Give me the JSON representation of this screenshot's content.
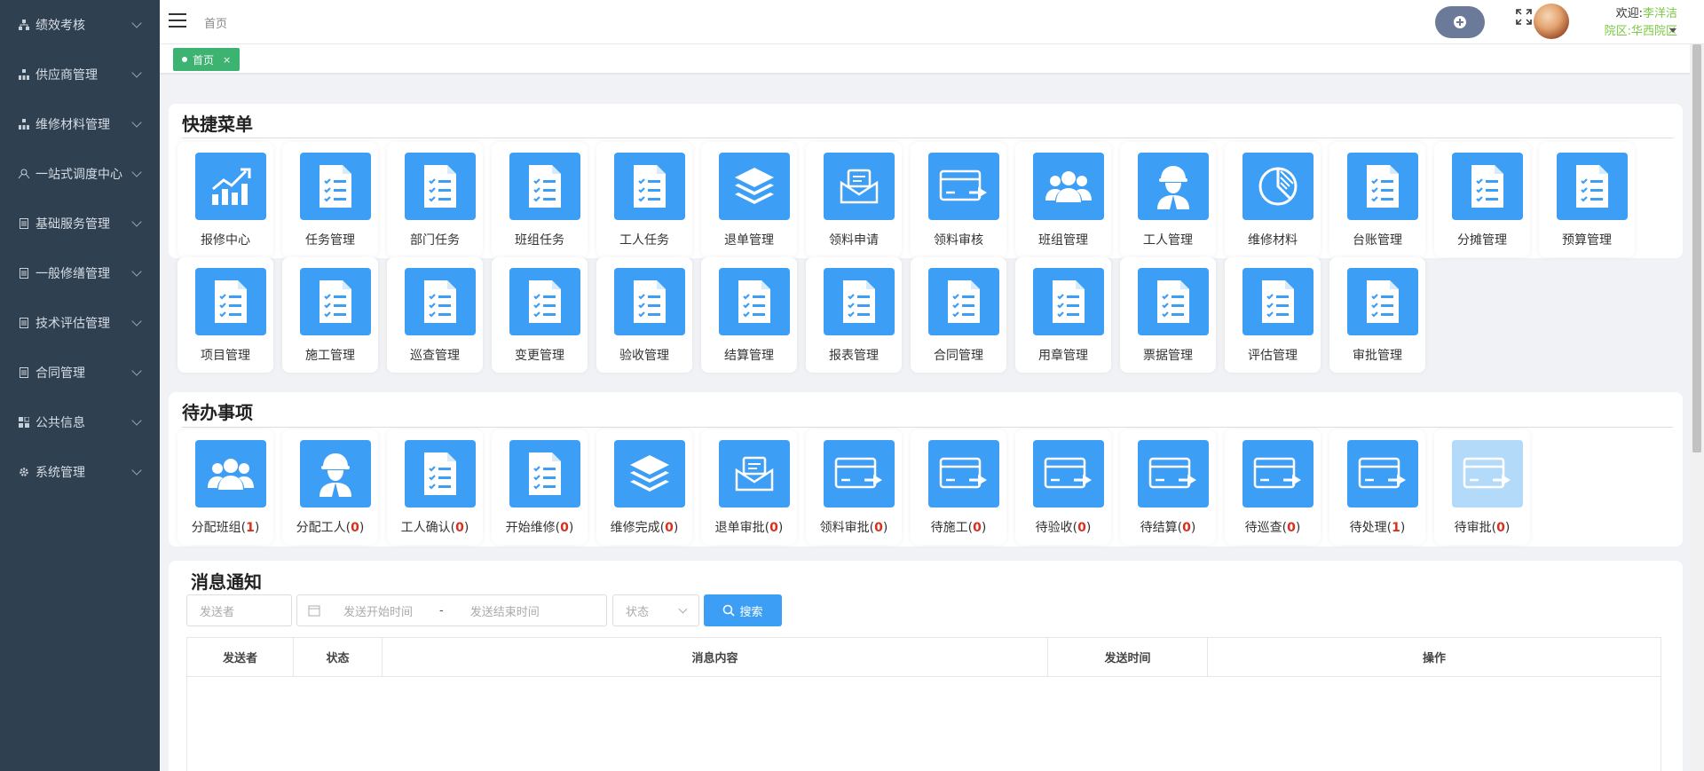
{
  "sidebar": {
    "items": [
      {
        "label": "绩效考核",
        "icon": "org-chart-icon"
      },
      {
        "label": "供应商管理",
        "icon": "sitemap-icon"
      },
      {
        "label": "维修材料管理",
        "icon": "sitemap-icon"
      },
      {
        "label": "一站式调度中心",
        "icon": "hub-icon"
      },
      {
        "label": "基础服务管理",
        "icon": "document-icon"
      },
      {
        "label": "一般修缮管理",
        "icon": "document-icon"
      },
      {
        "label": "技术评估管理",
        "icon": "document-icon"
      },
      {
        "label": "合同管理",
        "icon": "document-icon"
      },
      {
        "label": "公共信息",
        "icon": "grid-icon"
      },
      {
        "label": "系统管理",
        "icon": "gear-icon"
      }
    ]
  },
  "header": {
    "breadcrumb": "首页",
    "welcome_prefix": "欢迎:",
    "user_name": "李洋洁",
    "campus_prefix": "院区:",
    "campus_name": "华西院区"
  },
  "tabs": [
    {
      "label": "首页",
      "close": "×"
    }
  ],
  "quick_menu": {
    "title": "快捷菜单",
    "items": [
      {
        "label": "报修中心",
        "icon": "chart-up-icon"
      },
      {
        "label": "任务管理",
        "icon": "checklist-doc-icon"
      },
      {
        "label": "部门任务",
        "icon": "checklist-doc-icon"
      },
      {
        "label": "班组任务",
        "icon": "checklist-doc-icon"
      },
      {
        "label": "工人任务",
        "icon": "checklist-doc-icon"
      },
      {
        "label": "退单管理",
        "icon": "layers-icon"
      },
      {
        "label": "领料申请",
        "icon": "mail-icon"
      },
      {
        "label": "领料审核",
        "icon": "card-transfer-icon"
      },
      {
        "label": "班组管理",
        "icon": "users-icon"
      },
      {
        "label": "工人管理",
        "icon": "worker-icon"
      },
      {
        "label": "维修材料",
        "icon": "pie-icon"
      },
      {
        "label": "台账管理",
        "icon": "checklist-doc-icon"
      },
      {
        "label": "分摊管理",
        "icon": "checklist-doc-icon"
      },
      {
        "label": "预算管理",
        "icon": "checklist-doc-icon"
      },
      {
        "label": "项目管理",
        "icon": "checklist-doc-icon"
      },
      {
        "label": "施工管理",
        "icon": "checklist-doc-icon"
      },
      {
        "label": "巡查管理",
        "icon": "checklist-doc-icon"
      },
      {
        "label": "变更管理",
        "icon": "checklist-doc-icon"
      },
      {
        "label": "验收管理",
        "icon": "checklist-doc-icon"
      },
      {
        "label": "结算管理",
        "icon": "checklist-doc-icon"
      },
      {
        "label": "报表管理",
        "icon": "checklist-doc-icon"
      },
      {
        "label": "合同管理",
        "icon": "checklist-doc-icon"
      },
      {
        "label": "用章管理",
        "icon": "checklist-doc-icon"
      },
      {
        "label": "票据管理",
        "icon": "checklist-doc-icon"
      },
      {
        "label": "评估管理",
        "icon": "checklist-doc-icon"
      },
      {
        "label": "审批管理",
        "icon": "checklist-doc-icon"
      }
    ]
  },
  "todo": {
    "title": "待办事项",
    "items": [
      {
        "label": "分配班组",
        "count": "1",
        "icon": "users-icon"
      },
      {
        "label": "分配工人",
        "count": "0",
        "icon": "worker-icon"
      },
      {
        "label": "工人确认",
        "count": "0",
        "icon": "checklist-doc-icon"
      },
      {
        "label": "开始维修",
        "count": "0",
        "icon": "checklist-doc-icon"
      },
      {
        "label": "维修完成",
        "count": "0",
        "icon": "layers-icon"
      },
      {
        "label": "退单审批",
        "count": "0",
        "icon": "mail-icon"
      },
      {
        "label": "领料审批",
        "count": "0",
        "icon": "card-transfer-icon"
      },
      {
        "label": "待施工",
        "count": "0",
        "icon": "card-transfer-icon"
      },
      {
        "label": "待验收",
        "count": "0",
        "icon": "card-transfer-icon"
      },
      {
        "label": "待结算",
        "count": "0",
        "icon": "card-transfer-icon"
      },
      {
        "label": "待巡查",
        "count": "0",
        "icon": "card-transfer-icon"
      },
      {
        "label": "待处理",
        "count": "1",
        "icon": "card-transfer-icon"
      },
      {
        "label": "待审批",
        "count": "0",
        "icon": "card-transfer-icon",
        "light": true
      }
    ]
  },
  "messages": {
    "title": "消息通知",
    "sender_placeholder": "发送者",
    "start_placeholder": "发送开始时间",
    "range_sep": "-",
    "end_placeholder": "发送结束时间",
    "status_placeholder": "状态",
    "search_label": "搜索",
    "columns": [
      "发送者",
      "状态",
      "消息内容",
      "发送时间",
      "操作"
    ]
  },
  "colors": {
    "accent": "#3d9ef5",
    "sidebar": "#2f4050",
    "tab": "#3cb371",
    "alert": "#d9301e"
  }
}
